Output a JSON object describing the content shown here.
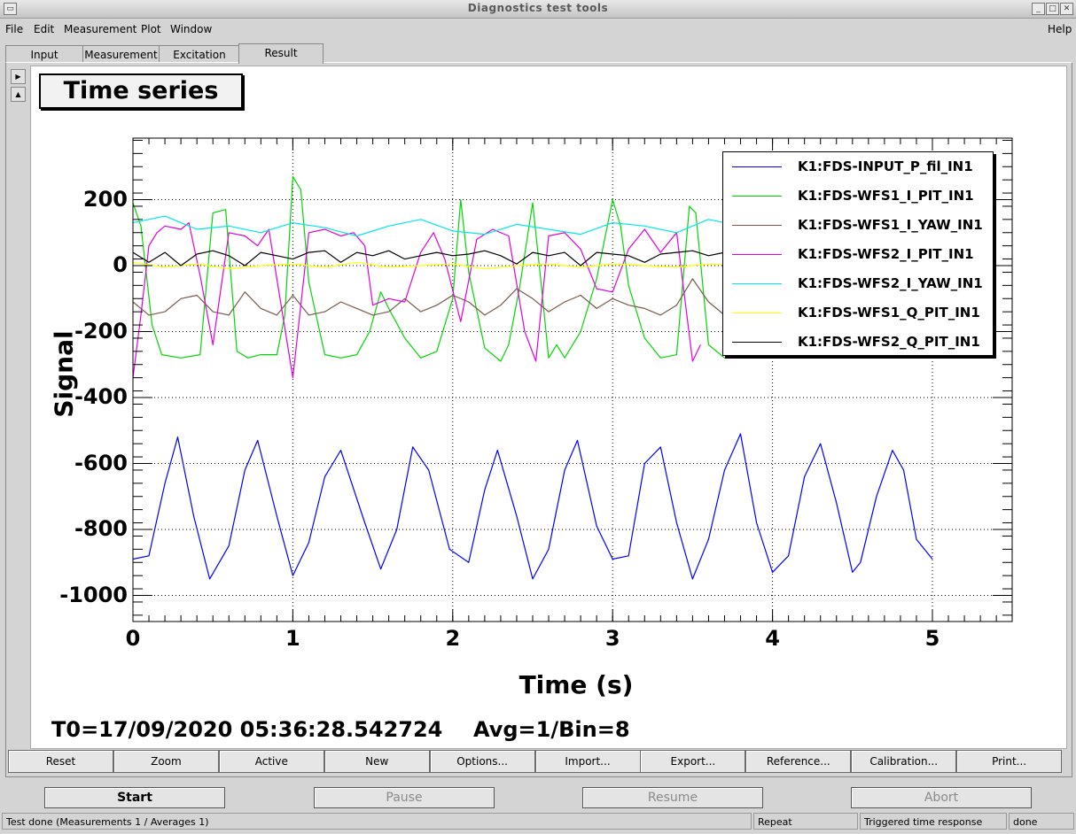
{
  "window": {
    "title": "Diagnostics test tools"
  },
  "menu": {
    "file": "File",
    "edit": "Edit",
    "measurement": "Measurement",
    "plot": "Plot",
    "window": "Window",
    "help": "Help"
  },
  "tabs": [
    "Input",
    "Measurement",
    "Excitation",
    "Result"
  ],
  "active_tab": "Result",
  "graph": {
    "title": "Time series",
    "t0": "T0=17/09/2020 05:36:28.542724",
    "avg": "Avg=1/Bin=8"
  },
  "chart_data": {
    "type": "line",
    "title": "Time series",
    "xlabel": "Time (s)",
    "ylabel": "Signal",
    "xlim": [
      0,
      5.5
    ],
    "ylim": [
      -1080,
      390
    ],
    "xticks": [
      "0",
      "1",
      "2",
      "3",
      "4",
      "5"
    ],
    "yticks": [
      "200",
      "0",
      "-200",
      "-400",
      "-600",
      "-800",
      "-1000"
    ],
    "grid": true,
    "legend_position": "top-right",
    "series": [
      {
        "name": "K1:FDS-INPUT_P_fil_IN1",
        "color": "#0000ff",
        "x": [
          0,
          0.1,
          0.2,
          0.28,
          0.38,
          0.48,
          0.6,
          0.7,
          0.78,
          0.9,
          1.0,
          1.1,
          1.2,
          1.3,
          1.45,
          1.55,
          1.65,
          1.75,
          1.85,
          1.98,
          2.1,
          2.2,
          2.28,
          2.4,
          2.5,
          2.6,
          2.7,
          2.78,
          2.9,
          3.0,
          3.1,
          3.2,
          3.3,
          3.4,
          3.5,
          3.6,
          3.7,
          3.8,
          3.9,
          4.0,
          4.1,
          4.2,
          4.3,
          4.4,
          4.5,
          4.55,
          4.65,
          4.75,
          4.82,
          4.9,
          5.0
        ],
        "y": [
          -890,
          -880,
          -660,
          -520,
          -760,
          -950,
          -850,
          -620,
          -530,
          -760,
          -940,
          -840,
          -640,
          -560,
          -780,
          -920,
          -800,
          -550,
          -620,
          -860,
          -900,
          -680,
          -560,
          -760,
          -950,
          -860,
          -620,
          -530,
          -790,
          -890,
          -880,
          -600,
          -550,
          -780,
          -950,
          -830,
          -620,
          -510,
          -780,
          -930,
          -880,
          -640,
          -540,
          -720,
          -930,
          -900,
          -700,
          -560,
          -620,
          -830,
          -890
        ]
      },
      {
        "name": "K1:FDS-WFS1_I_PIT_IN1",
        "color": "#00d800",
        "x": [
          0,
          0.05,
          0.12,
          0.18,
          0.3,
          0.42,
          0.5,
          0.58,
          0.65,
          0.72,
          0.8,
          0.9,
          0.95,
          1.0,
          1.05,
          1.1,
          1.2,
          1.3,
          1.4,
          1.48,
          1.55,
          1.6,
          1.7,
          1.8,
          1.9,
          2.0,
          2.05,
          2.1,
          2.2,
          2.3,
          2.35,
          2.42,
          2.5,
          2.55,
          2.6,
          2.65,
          2.7,
          2.8,
          2.9,
          3.0,
          3.05,
          3.1,
          3.2,
          3.3,
          3.4,
          3.48,
          3.52,
          3.6,
          3.7,
          3.8
        ],
        "y": [
          190,
          120,
          -180,
          -270,
          -280,
          -270,
          160,
          170,
          -260,
          -280,
          -270,
          -270,
          -150,
          270,
          230,
          -50,
          -270,
          -280,
          -270,
          -200,
          -80,
          -130,
          -220,
          -280,
          -260,
          -100,
          200,
          -20,
          -250,
          -290,
          -240,
          -60,
          190,
          -40,
          -280,
          -240,
          -280,
          -200,
          -40,
          200,
          120,
          -60,
          -220,
          -280,
          -270,
          180,
          160,
          -240,
          -280,
          -280
        ]
      },
      {
        "name": "K1:FDS-WFS1_I_YAW_IN1",
        "color": "#7a5a4a",
        "x": [
          0,
          0.1,
          0.2,
          0.3,
          0.4,
          0.5,
          0.6,
          0.7,
          0.8,
          0.9,
          1.0,
          1.1,
          1.2,
          1.3,
          1.4,
          1.5,
          1.6,
          1.7,
          1.8,
          1.9,
          2.0,
          2.1,
          2.2,
          2.3,
          2.4,
          2.5,
          2.6,
          2.7,
          2.8,
          2.9,
          3.0,
          3.1,
          3.2,
          3.3,
          3.4,
          3.5,
          3.6,
          3.7,
          3.8
        ],
        "y": [
          -110,
          -150,
          -140,
          -100,
          -90,
          -140,
          -150,
          -80,
          -130,
          -150,
          -90,
          -150,
          -140,
          -110,
          -130,
          -150,
          -140,
          -100,
          -140,
          -120,
          -90,
          -110,
          -150,
          -120,
          -70,
          -100,
          -140,
          -110,
          -90,
          -130,
          -100,
          -120,
          -130,
          -150,
          -120,
          -40,
          -110,
          -150,
          -100
        ]
      },
      {
        "name": "K1:FDS-WFS2_I_PIT_IN1",
        "color": "#e000e0",
        "x": [
          0,
          0.05,
          0.1,
          0.15,
          0.2,
          0.3,
          0.35,
          0.42,
          0.5,
          0.6,
          0.7,
          0.78,
          0.85,
          0.95,
          1.0,
          1.1,
          1.2,
          1.3,
          1.38,
          1.45,
          1.5,
          1.6,
          1.7,
          1.8,
          1.88,
          1.95,
          2.05,
          2.15,
          2.25,
          2.35,
          2.45,
          2.52,
          2.6,
          2.7,
          2.8,
          2.9,
          3.0,
          3.1,
          3.2,
          3.3,
          3.4,
          3.5,
          3.55
        ],
        "y": [
          -340,
          -150,
          60,
          100,
          120,
          110,
          130,
          -30,
          -240,
          100,
          90,
          60,
          110,
          -190,
          -340,
          100,
          110,
          90,
          100,
          60,
          -120,
          -100,
          -110,
          40,
          100,
          20,
          -170,
          80,
          110,
          90,
          -200,
          -290,
          90,
          100,
          50,
          -70,
          -80,
          50,
          110,
          40,
          100,
          -290,
          -240
        ]
      },
      {
        "name": "K1:FDS-WFS2_I_YAW_IN1",
        "color": "#00e8e8",
        "x": [
          0,
          0.2,
          0.4,
          0.6,
          0.8,
          1.0,
          1.2,
          1.4,
          1.6,
          1.8,
          2.0,
          2.2,
          2.4,
          2.6,
          2.8,
          3.0,
          3.2,
          3.4,
          3.6,
          3.8
        ],
        "y": [
          130,
          150,
          110,
          120,
          100,
          130,
          115,
          90,
          120,
          140,
          105,
          95,
          125,
          110,
          95,
          130,
          120,
          100,
          140,
          120
        ]
      },
      {
        "name": "K1:FDS-WFS1_Q_PIT_IN1",
        "color": "#ffff00",
        "x": [
          0,
          0.2,
          0.4,
          0.6,
          0.8,
          1.0,
          1.2,
          1.4,
          1.6,
          1.8,
          2.0,
          2.2,
          2.4,
          2.6,
          2.8,
          3.0,
          3.2,
          3.4,
          3.6,
          3.8
        ],
        "y": [
          10,
          -5,
          5,
          -10,
          0,
          5,
          -5,
          10,
          -5,
          0,
          5,
          -10,
          0,
          5,
          -5,
          5,
          0,
          -5,
          5,
          0
        ]
      },
      {
        "name": "K1:FDS-WFS2_Q_PIT_IN1",
        "color": "#000000",
        "x": [
          0,
          0.1,
          0.2,
          0.3,
          0.4,
          0.5,
          0.6,
          0.7,
          0.8,
          0.9,
          1.0,
          1.1,
          1.2,
          1.3,
          1.4,
          1.5,
          1.6,
          1.7,
          1.8,
          1.9,
          2.0,
          2.1,
          2.2,
          2.3,
          2.4,
          2.5,
          2.6,
          2.7,
          2.8,
          2.9,
          3.0,
          3.1,
          3.2,
          3.3,
          3.4,
          3.5,
          3.6,
          3.7,
          3.8
        ],
        "y": [
          40,
          10,
          40,
          0,
          35,
          45,
          30,
          0,
          40,
          30,
          20,
          40,
          45,
          10,
          40,
          30,
          45,
          20,
          30,
          40,
          30,
          35,
          45,
          30,
          5,
          40,
          30,
          40,
          0,
          40,
          35,
          30,
          10,
          35,
          40,
          45,
          30,
          40,
          40
        ]
      }
    ]
  },
  "toolbar": [
    "Reset",
    "Zoom",
    "Active",
    "New",
    "Options...",
    "Import...",
    "Export...",
    "Reference...",
    "Calibration...",
    "Print..."
  ],
  "controls": {
    "start": "Start",
    "pause": "Pause",
    "resume": "Resume",
    "abort": "Abort"
  },
  "status": {
    "message": "Test done (Measurements 1 / Averages 1)",
    "mode": "Repeat",
    "type": "Triggered time response",
    "state": "done"
  }
}
